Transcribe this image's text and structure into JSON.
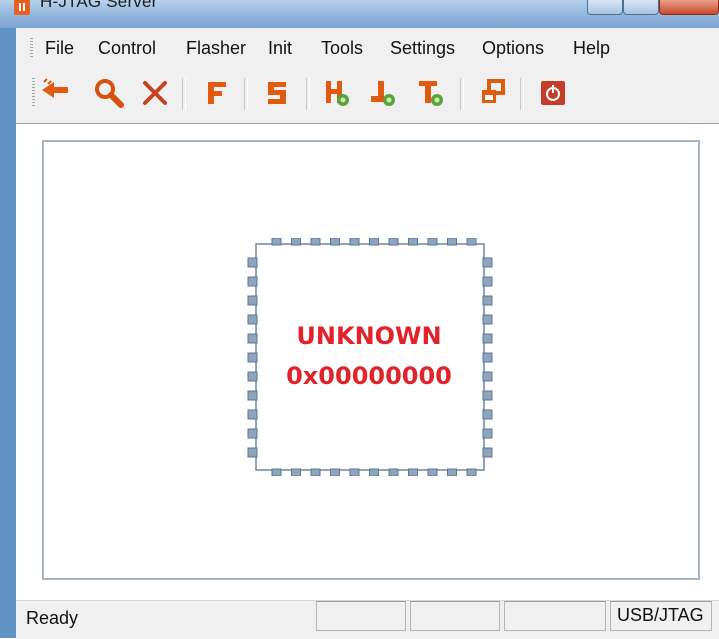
{
  "window": {
    "title": "H-JTAG Server"
  },
  "menubar": {
    "items": [
      "File",
      "Control",
      "Flasher",
      "Init",
      "Tools",
      "Settings",
      "Options",
      "Help"
    ]
  },
  "toolbar": {
    "buttons": [
      {
        "icon": "detect-target-arrow-icon",
        "color": "#e05a10"
      },
      {
        "icon": "search-magnifier-icon",
        "color": "#d94f10"
      },
      {
        "icon": "close-x-icon",
        "color": "#c44422"
      },
      {
        "icon": "flasher-f-icon",
        "color": "#e05a10"
      },
      {
        "icon": "settings-s-icon",
        "color": "#e05a10"
      },
      {
        "icon": "init-h-gear-icon",
        "color": "#e05a10"
      },
      {
        "icon": "jtag-j-gear-icon",
        "color": "#e05a10"
      },
      {
        "icon": "tools-t-gear-icon",
        "color": "#e05a10"
      },
      {
        "icon": "window-restore-icon",
        "color": "#e05a10"
      },
      {
        "icon": "power-icon",
        "color": "#c43c2a"
      }
    ]
  },
  "chip": {
    "name": "UNKNOWN",
    "id": "0x00000000",
    "text_color": "#e3232b",
    "pin_color": "#8fa4bd"
  },
  "status": {
    "text": "Ready",
    "panes": [
      "",
      "",
      "",
      "USB/JTAG"
    ]
  }
}
